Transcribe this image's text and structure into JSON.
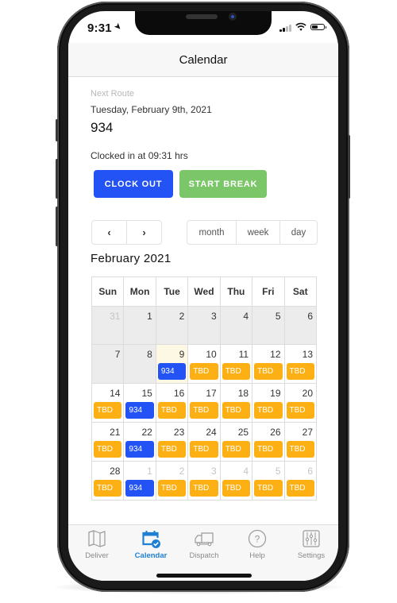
{
  "status_bar": {
    "time": "9:31"
  },
  "header": {
    "title": "Calendar"
  },
  "next_route": {
    "label": "Next Route",
    "date": "Tuesday, February 9th, 2021",
    "route_number": "934",
    "clocked_in": "Clocked in at 09:31 hrs"
  },
  "actions": {
    "clock_out": "CLOCK OUT",
    "start_break": "START BREAK"
  },
  "colors": {
    "primary": "#2353f5",
    "break": "#7cc66a",
    "tbd": "#fdb014",
    "active_tab": "#1f7fd3",
    "today": "#fcf8e3"
  },
  "calendar": {
    "prev": "‹",
    "next": "›",
    "views": [
      "month",
      "week",
      "day"
    ],
    "month_title": "February 2021",
    "weekdays": [
      "Sun",
      "Mon",
      "Tue",
      "Wed",
      "Thu",
      "Fri",
      "Sat"
    ],
    "weeks": [
      [
        {
          "d": "31",
          "o": true,
          "p": true
        },
        {
          "d": "1",
          "p": true
        },
        {
          "d": "2",
          "p": true
        },
        {
          "d": "3",
          "p": true
        },
        {
          "d": "4",
          "p": true
        },
        {
          "d": "5",
          "p": true
        },
        {
          "d": "6",
          "p": true
        }
      ],
      [
        {
          "d": "7",
          "p": true
        },
        {
          "d": "8",
          "p": true
        },
        {
          "d": "9",
          "t": true,
          "e": "934"
        },
        {
          "d": "10",
          "e": "TBD"
        },
        {
          "d": "11",
          "e": "TBD"
        },
        {
          "d": "12",
          "e": "TBD"
        },
        {
          "d": "13",
          "e": "TBD"
        }
      ],
      [
        {
          "d": "14",
          "e": "TBD"
        },
        {
          "d": "15",
          "e": "934"
        },
        {
          "d": "16",
          "e": "TBD"
        },
        {
          "d": "17",
          "e": "TBD"
        },
        {
          "d": "18",
          "e": "TBD"
        },
        {
          "d": "19",
          "e": "TBD"
        },
        {
          "d": "20",
          "e": "TBD"
        }
      ],
      [
        {
          "d": "21",
          "e": "TBD"
        },
        {
          "d": "22",
          "e": "934"
        },
        {
          "d": "23",
          "e": "TBD"
        },
        {
          "d": "24",
          "e": "TBD"
        },
        {
          "d": "25",
          "e": "TBD"
        },
        {
          "d": "26",
          "e": "TBD"
        },
        {
          "d": "27",
          "e": "TBD"
        }
      ],
      [
        {
          "d": "28",
          "e": "TBD"
        },
        {
          "d": "1",
          "o": true,
          "e": "934"
        },
        {
          "d": "2",
          "o": true,
          "e": "TBD"
        },
        {
          "d": "3",
          "o": true,
          "e": "TBD"
        },
        {
          "d": "4",
          "o": true,
          "e": "TBD"
        },
        {
          "d": "5",
          "o": true,
          "e": "TBD"
        },
        {
          "d": "6",
          "o": true,
          "e": "TBD"
        }
      ]
    ]
  },
  "tabs": [
    {
      "label": "Deliver",
      "icon": "map-icon"
    },
    {
      "label": "Calendar",
      "icon": "calendar-check-icon",
      "active": true
    },
    {
      "label": "Dispatch",
      "icon": "truck-icon"
    },
    {
      "label": "Help",
      "icon": "help-icon"
    },
    {
      "label": "Settings",
      "icon": "settings-sliders-icon"
    }
  ]
}
